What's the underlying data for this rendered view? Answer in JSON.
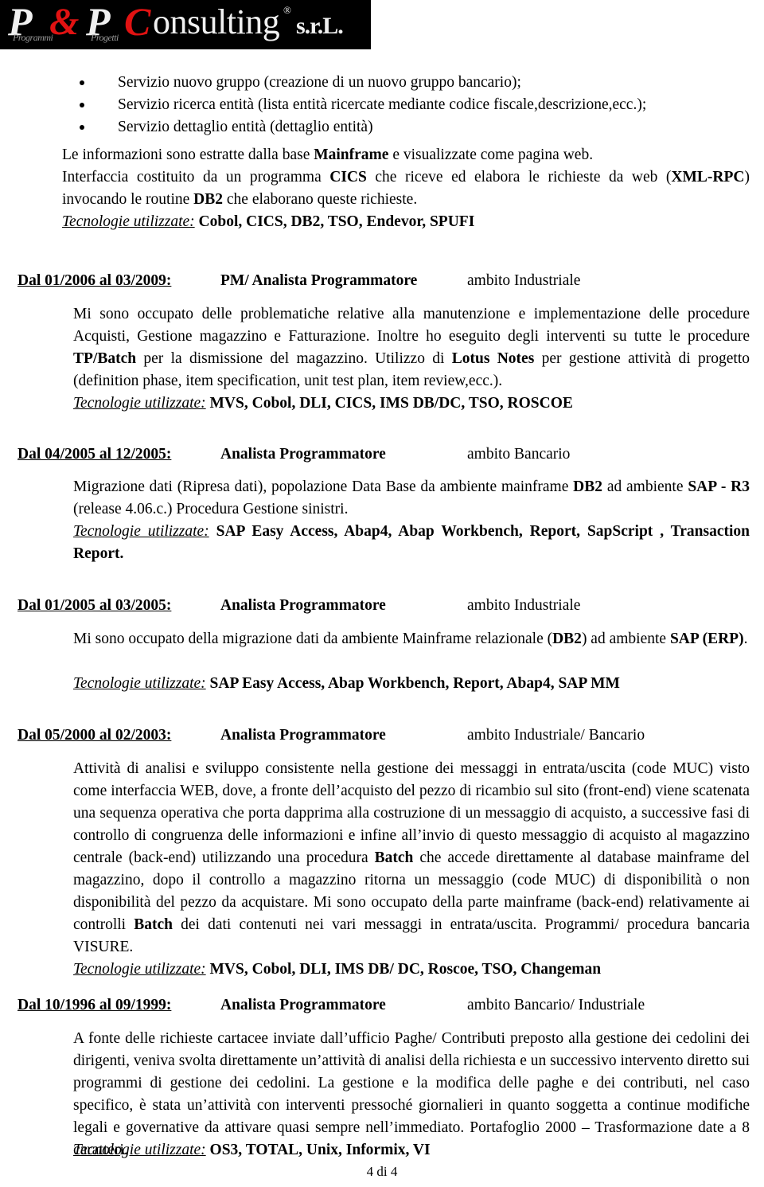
{
  "logo": {
    "p1": "P",
    "sub1": "Programmi",
    "amp": "&",
    "p2": "P",
    "sub2": "Progetti",
    "c": "C",
    "rest": "onsulting",
    "registered": "®",
    "srl": "s.r.L."
  },
  "bullets": [
    "Servizio nuovo gruppo (creazione di un nuovo gruppo bancario);",
    "Servizio ricerca entità (lista entità ricercate mediante codice fiscale,descrizione,ecc.);",
    "Servizio dettaglio entità (dettaglio entità)"
  ],
  "intro": {
    "line1_a": "Le informazioni sono estratte dalla base ",
    "line1_b": "Mainframe",
    "line1_c": " e visualizzate come pagina web.",
    "line2_a": "Interfaccia costituito da un programma ",
    "line2_b": "CICS",
    "line2_c": " che riceve ed elabora le richieste da web (",
    "line2_d": "XML-RPC",
    "line2_e": ") invocando le routine ",
    "line2_f": "DB2",
    "line2_g": " che elaborano queste  richieste.",
    "tec_label": "Tecnologie utilizzate:",
    "tec_value": " Cobol, CICS, DB2, TSO, Endevor, SPUFI"
  },
  "jobs": [
    {
      "date": "Dal 01/2006 al 03/2009:",
      "role": "PM/ Analista Programmatore",
      "scope": "ambito Industriale",
      "body": {
        "t1": "Mi sono occupato delle problematiche relative alla manutenzione e implementazione delle procedure Acquisti, Gestione magazzino e Fatturazione. Inoltre ho eseguito degli interventi su tutte le procedure ",
        "b1": "TP/Batch",
        "t2": " per la dismissione del magazzino. Utilizzo di ",
        "b2": "Lotus Notes",
        "t3": " per gestione attività di progetto (definition phase, item specification, unit test plan,  item review,ecc.)."
      },
      "tec_label": "Tecnologie utilizzate:",
      "tec_value": " MVS, Cobol, DLI, CICS, IMS DB/DC, TSO, ROSCOE"
    },
    {
      "date": "Dal 04/2005 al 12/2005:",
      "role": "Analista Programmatore",
      "scope": "ambito Bancario",
      "body": {
        "t1": "Migrazione dati (Ripresa dati), popolazione Data Base da ambiente mainframe ",
        "b1": "DB2",
        "t2": " ad ambiente ",
        "b2": "SAP  - R3",
        "t3": " (release 4.06.c.) Procedura Gestione sinistri."
      },
      "tec_label": "Tecnologie utilizzate:",
      "tec_value": " SAP Easy Access, Abap4, Abap Workbench, Report, SapScript , Transaction Report."
    },
    {
      "date": "Dal 01/2005 al 03/2005:",
      "role": "Analista Programmatore",
      "scope": "ambito Industriale",
      "body": {
        "t1": "Mi sono occupato della migrazione dati da ambiente Mainframe relazionale (",
        "b1": "DB2",
        "t2": ") ad ambiente ",
        "b2": "SAP (ERP)",
        "t3": "."
      },
      "tec_label": "Tecnologie utilizzate:",
      "tec_value": " SAP Easy Access, Abap Workbench, Report, Abap4,  SAP MM"
    },
    {
      "date": "Dal 05/2000 al 02/2003:",
      "role": "Analista Programmatore",
      "scope": "ambito Industriale/ Bancario",
      "body": {
        "t1": "Attività di analisi e sviluppo consistente nella gestione dei messaggi in entrata/uscita (code MUC) visto come interfaccia WEB, dove, a fronte dell’acquisto del pezzo di ricambio sul sito (front-end) viene scatenata una sequenza operativa che porta dapprima alla costruzione di un messaggio di acquisto, a successive fasi di controllo di congruenza delle informazioni e infine all’invio di questo messaggio di acquisto al magazzino centrale (back-end) utilizzando una procedura ",
        "b1": "Batch",
        "t2": " che accede direttamente al database mainframe del magazzino, dopo il controllo a magazzino ritorna un messaggio (code MUC) di disponibilità o non disponibilità del pezzo da acquistare. Mi sono occupato della parte mainframe (back-end) relativamente ai controlli ",
        "b2": "Batch",
        "t3": " dei dati contenuti nei vari messaggi in entrata/uscita. Programmi/ procedura bancaria VISURE."
      },
      "tec_label": "Tecnologie utilizzate:",
      "tec_value": " MVS, Cobol, DLI, IMS DB/ DC, Roscoe, TSO, Changeman"
    },
    {
      "date": "Dal 10/1996 al 09/1999:",
      "role": "Analista Programmatore",
      "scope": "ambito Bancario/ Industriale",
      "body": {
        "t1": "A fonte delle richieste cartacee inviate dall’ufficio Paghe/ Contributi preposto alla gestione dei cedolini dei dirigenti, veniva svolta direttamente un’attività di analisi della richiesta e un successivo intervento diretto sui programmi di gestione dei cedolini. La gestione e la modifica delle paghe e dei contributi, nel caso specifico, è stata un’attività con interventi pressoché giornalieri in quanto soggetta a continue modifiche legali e governative da attivare quasi sempre nell’immediato. Portafoglio 2000 – Trasformazione date a 8 caratteri.",
        "b1": "",
        "t2": "",
        "b2": "",
        "t3": ""
      },
      "tec_label": "Tecnologie utilizzate:",
      "tec_value": " OS3, TOTAL, Unix,  Informix, VI"
    }
  ],
  "footer": {
    "page_number": "4 di 4"
  }
}
